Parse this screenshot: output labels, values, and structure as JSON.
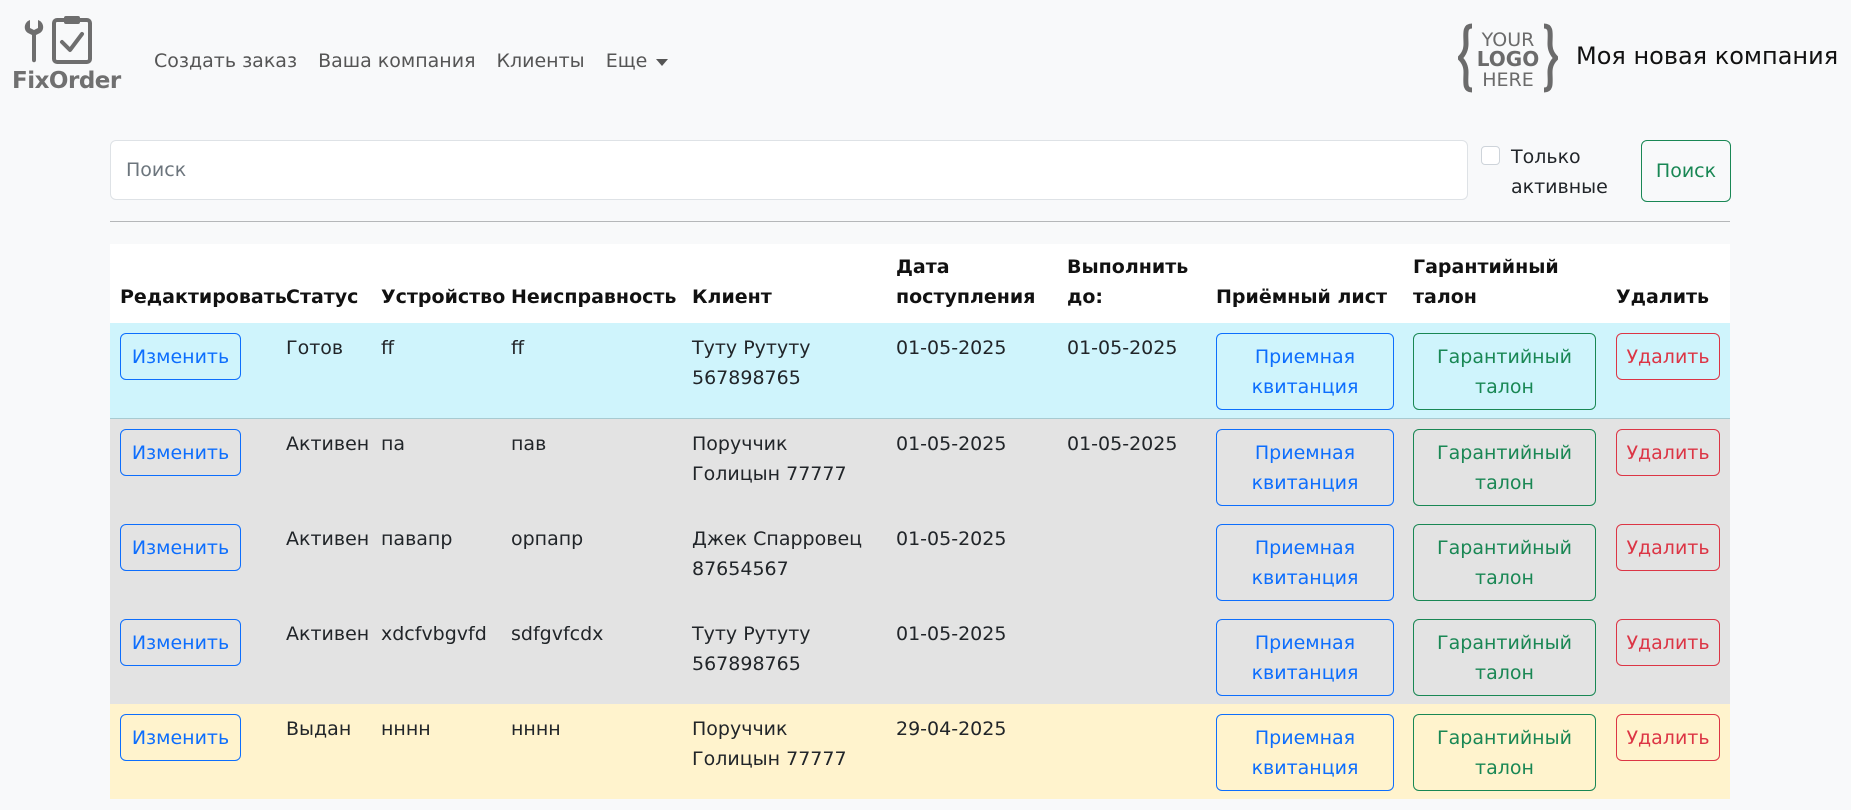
{
  "brand": {
    "name": "FixOrder"
  },
  "nav": {
    "items": [
      "Создать заказ",
      "Ваша компания",
      "Клиенты"
    ],
    "more_label": "Еще"
  },
  "company": {
    "logo_text": [
      "YOUR",
      "LOGO",
      "HERE"
    ],
    "name": "Моя новая компания"
  },
  "search": {
    "placeholder": "Поиск",
    "value": "",
    "only_active_label": "Только активные",
    "only_active_checked": false,
    "button_label": "Поиск"
  },
  "table": {
    "headers": [
      "Редактировать",
      "Статус",
      "Устройство",
      "Неисправность",
      "Клиент",
      "Дата поступления",
      "Выполнить до:",
      "Приёмный лист",
      "Гарантийный талон",
      "Удалить"
    ],
    "edit_label": "Изменить",
    "receipt_label": "Приемная квитанция",
    "warranty_label": "Гарантийный талон",
    "delete_label": "Удалить",
    "rows": [
      {
        "variant": "info",
        "status": "Готов",
        "device": "ff",
        "fault": "ff",
        "client": "Туту Рутуту 567898765",
        "received": "01-05-2025",
        "due": "01-05-2025"
      },
      {
        "variant": "gray",
        "status": "Активен",
        "device": "па",
        "fault": "пав",
        "client": "Поруччик Голицын 77777",
        "received": "01-05-2025",
        "due": "01-05-2025"
      },
      {
        "variant": "gray",
        "status": "Активен",
        "device": "павапр",
        "fault": "орпапр",
        "client": "Джек Спарровец 87654567",
        "received": "01-05-2025",
        "due": ""
      },
      {
        "variant": "gray",
        "status": "Активен",
        "device": "xdcfvbgvfd",
        "fault": "sdfgvfcdx",
        "client": "Туту Рутуту 567898765",
        "received": "01-05-2025",
        "due": ""
      },
      {
        "variant": "warn",
        "status": "Выдан",
        "device": "нннн",
        "fault": "нннн",
        "client": "Поруччик Голицын 77777",
        "received": "29-04-2025",
        "due": ""
      }
    ]
  },
  "colors": {
    "primary": "#0d6efd",
    "success": "#198754",
    "danger": "#dc3545",
    "row_info": "#cff4fc",
    "row_gray": "#e3e3e3",
    "row_warning": "#fff3cd"
  }
}
